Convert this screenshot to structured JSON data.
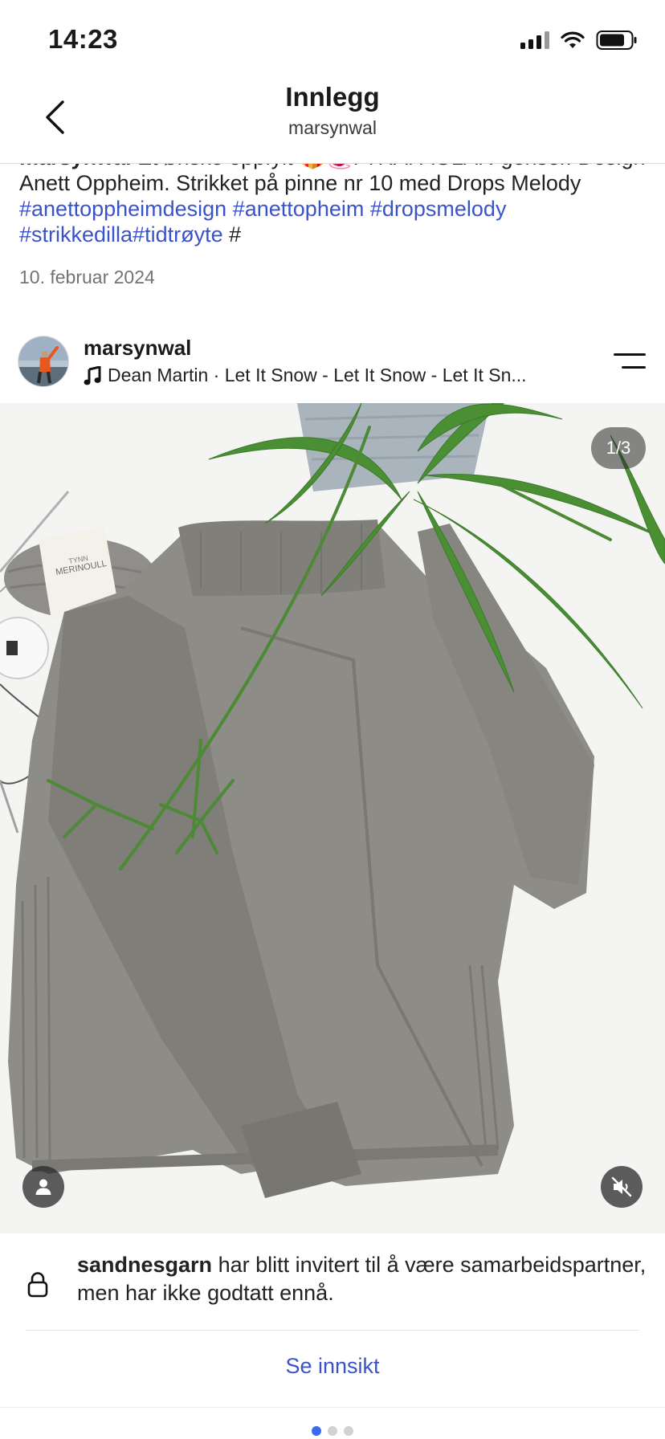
{
  "status_bar": {
    "time": "14:23"
  },
  "nav": {
    "title": "Innlegg",
    "subtitle": "marsynwal"
  },
  "caption": {
    "username": "marsynwal",
    "text": " Et ønske oppfylt 🎁🧶. TRAFAGLAR-genser. Design Anett Oppheim.  Strikket på pinne nr 10 med Drops Melody  ",
    "hashtags": [
      "#anettoppheimdesign",
      "#anettopheim",
      "#dropsmelody",
      "#strikkedilla#tidtrøyte"
    ],
    "trailing": " #",
    "date": "10. februar 2024"
  },
  "post": {
    "username": "marsynwal",
    "music": "Dean Martin · Let It Snow - Let It Snow - Let It Sn...",
    "image_counter": "1/3",
    "yarn_label_top": "TYNN",
    "yarn_label_bottom": "MERINOULL"
  },
  "notice": {
    "account": "sandnesgarn",
    "text": " har blitt invitert til å være samarbeidspartner, men har ikke godtatt ennå."
  },
  "insight_link": "Se innsikt",
  "pagination": {
    "total": 3,
    "active": 1
  },
  "colors": {
    "link": "#3b53c9",
    "page_dot_active": "#3b6af0",
    "sweater": "#8d8c87"
  },
  "icons": [
    "back-chevron-icon",
    "music-note-icon",
    "menu-lines-icon",
    "person-tag-icon",
    "speaker-muted-icon",
    "lock-icon",
    "signal-icon",
    "wifi-icon",
    "battery-icon"
  ]
}
